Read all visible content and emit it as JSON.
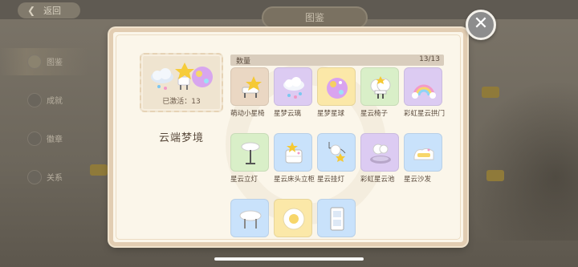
{
  "background": {
    "back_label": "返回",
    "title_tab": "图鉴",
    "side_items": [
      {
        "label": "图鉴",
        "active": true
      },
      {
        "label": "成就",
        "active": false
      },
      {
        "label": "徽章",
        "active": false
      },
      {
        "label": "关系",
        "active": false
      }
    ]
  },
  "close_button": {
    "icon": "close-icon",
    "glyph": "✕"
  },
  "preview": {
    "activated_label": "已激活：13",
    "set_name": "云端梦境"
  },
  "list": {
    "header_label": "数量",
    "count": "13/13",
    "items": [
      {
        "name": "萌动小星椅",
        "color": "brown",
        "icon": "star-chair-icon"
      },
      {
        "name": "星梦云璃",
        "color": "purple",
        "icon": "cloud-crystal-icon"
      },
      {
        "name": "星梦星球",
        "color": "yellow",
        "icon": "star-planet-icon"
      },
      {
        "name": "星云椅子",
        "color": "green",
        "icon": "cloud-chair-icon"
      },
      {
        "name": "彩虹星云拱门",
        "color": "purple",
        "icon": "rainbow-arch-icon"
      },
      {
        "name": "星云立灯",
        "color": "green",
        "icon": "floor-lamp-icon"
      },
      {
        "name": "星云床头立柜",
        "color": "blue",
        "icon": "bedside-cabinet-icon"
      },
      {
        "name": "星云挂灯",
        "color": "blue",
        "icon": "hanging-lamp-icon"
      },
      {
        "name": "彩虹星云池",
        "color": "purple",
        "icon": "rainbow-pool-icon"
      },
      {
        "name": "星云沙发",
        "color": "blue",
        "icon": "cloud-sofa-icon"
      },
      {
        "name": "",
        "color": "blue",
        "icon": "cloud-table-icon"
      },
      {
        "name": "",
        "color": "yellow",
        "icon": "cloud-rug-icon"
      },
      {
        "name": "",
        "color": "blue",
        "icon": "cloud-wardrobe-icon"
      }
    ]
  }
}
